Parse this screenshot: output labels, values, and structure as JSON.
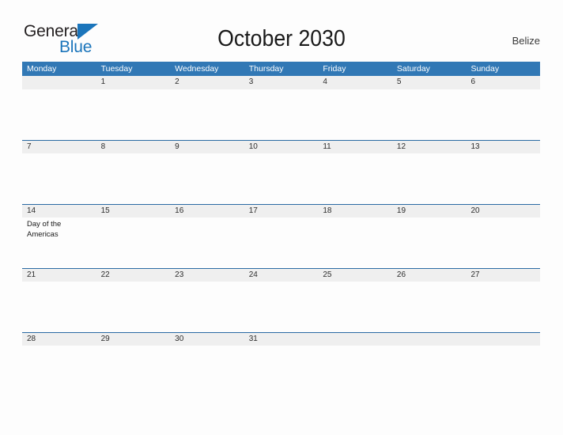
{
  "brand": {
    "name_part1": "General",
    "name_part2": "Blue",
    "flag_icon": "triangle-flag-icon",
    "accent_color": "#1b75bb"
  },
  "header": {
    "title": "October 2030",
    "country": "Belize"
  },
  "theme": {
    "header_blue": "#3178b5",
    "rule_blue": "#2a6aa3",
    "band_gray": "#efefef",
    "page_background": "#fdfdfd"
  },
  "calendar": {
    "weekdays": [
      "Monday",
      "Tuesday",
      "Wednesday",
      "Thursday",
      "Friday",
      "Saturday",
      "Sunday"
    ],
    "weeks": [
      {
        "days": [
          {
            "num": "",
            "event": ""
          },
          {
            "num": "1",
            "event": ""
          },
          {
            "num": "2",
            "event": ""
          },
          {
            "num": "3",
            "event": ""
          },
          {
            "num": "4",
            "event": ""
          },
          {
            "num": "5",
            "event": ""
          },
          {
            "num": "6",
            "event": ""
          }
        ]
      },
      {
        "days": [
          {
            "num": "7",
            "event": ""
          },
          {
            "num": "8",
            "event": ""
          },
          {
            "num": "9",
            "event": ""
          },
          {
            "num": "10",
            "event": ""
          },
          {
            "num": "11",
            "event": ""
          },
          {
            "num": "12",
            "event": ""
          },
          {
            "num": "13",
            "event": ""
          }
        ]
      },
      {
        "days": [
          {
            "num": "14",
            "event": "Day of the Americas"
          },
          {
            "num": "15",
            "event": ""
          },
          {
            "num": "16",
            "event": ""
          },
          {
            "num": "17",
            "event": ""
          },
          {
            "num": "18",
            "event": ""
          },
          {
            "num": "19",
            "event": ""
          },
          {
            "num": "20",
            "event": ""
          }
        ]
      },
      {
        "days": [
          {
            "num": "21",
            "event": ""
          },
          {
            "num": "22",
            "event": ""
          },
          {
            "num": "23",
            "event": ""
          },
          {
            "num": "24",
            "event": ""
          },
          {
            "num": "25",
            "event": ""
          },
          {
            "num": "26",
            "event": ""
          },
          {
            "num": "27",
            "event": ""
          }
        ]
      },
      {
        "days": [
          {
            "num": "28",
            "event": ""
          },
          {
            "num": "29",
            "event": ""
          },
          {
            "num": "30",
            "event": ""
          },
          {
            "num": "31",
            "event": ""
          },
          {
            "num": "",
            "event": ""
          },
          {
            "num": "",
            "event": ""
          },
          {
            "num": "",
            "event": ""
          }
        ]
      }
    ]
  }
}
